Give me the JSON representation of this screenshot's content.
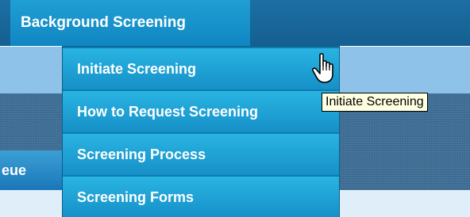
{
  "nav": {
    "active_tab": "Background Screening",
    "queue_tab_partial": "eue"
  },
  "menu": {
    "items": [
      {
        "label": "Initiate Screening"
      },
      {
        "label": "How to Request Screening"
      },
      {
        "label": "Screening Process"
      },
      {
        "label": "Screening Forms"
      }
    ]
  },
  "tooltip": {
    "text": "Initiate Screening"
  },
  "cursor": {
    "icon": "hand-pointer-cursor"
  }
}
